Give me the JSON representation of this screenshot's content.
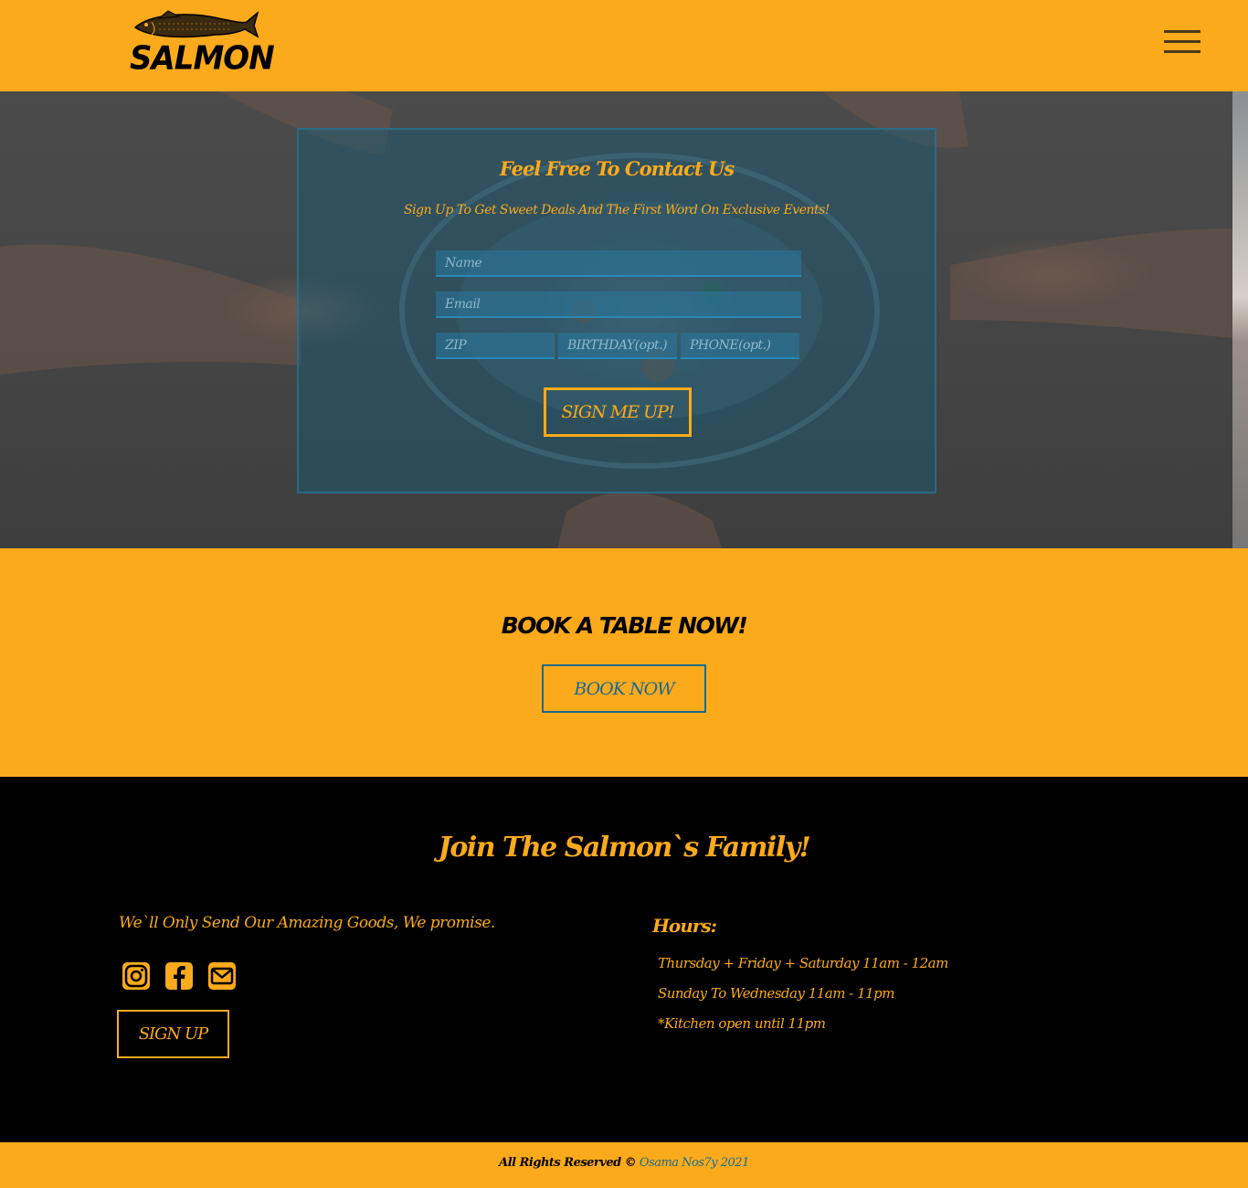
{
  "header": {
    "logo_text": "SALMON",
    "menu_icon": "hamburger-menu-icon"
  },
  "hero": {
    "title": "Feel Free To Contact Us",
    "subtitle": "Sign Up To Get Sweet Deals And The First Word On Exclusive Events!",
    "fields": {
      "name_placeholder": "Name",
      "email_placeholder": "Email",
      "zip_placeholder": "ZIP",
      "birthday_placeholder": "BIRTHDAY(opt.)",
      "phone_placeholder": "PHONE(opt.)"
    },
    "submit_label": "SIGN ME UP!"
  },
  "book": {
    "title": "BOOK A TABLE NOW!",
    "button_label": "BOOK NOW"
  },
  "footer": {
    "title": "Join The Salmon`s Family!",
    "promise": "We`ll Only Send Our Amazing Goods, We promise.",
    "socials": [
      "instagram-icon",
      "facebook-icon",
      "envelope-icon"
    ],
    "signup_label": "SIGN UP",
    "hours_title": "Hours:",
    "hours": [
      "Thursday + Friday + Saturday 11am - 12am",
      "Sunday To Wednesday 11am - 11pm",
      "*Kitchen open until 11pm"
    ],
    "copyright_text": "All Rights Reserved ©",
    "author": "Osama Nos7y 2021"
  },
  "colors": {
    "accent": "#fbaa1c",
    "link": "#1b6a8e",
    "background_dark": "#000000"
  }
}
